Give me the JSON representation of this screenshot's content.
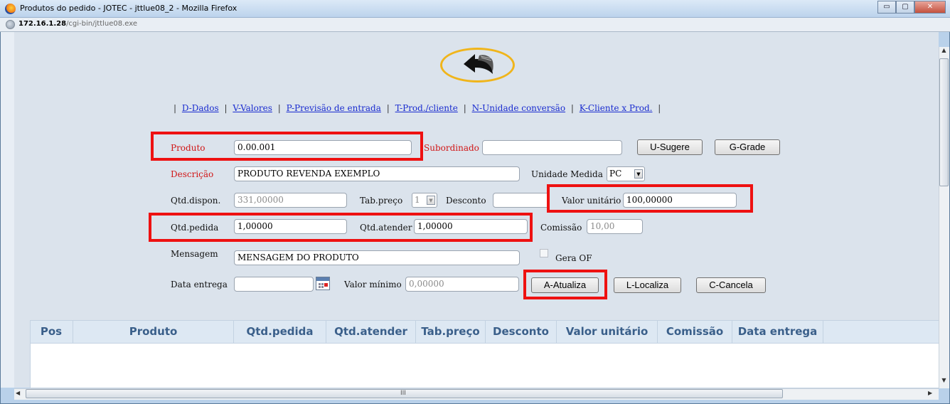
{
  "window": {
    "title": "Produtos do pedido - JOTEC - jttlue08_2 - Mozilla Firefox",
    "url_host": "172.16.1.28",
    "url_path": "/cgi-bin/jttlue08.exe",
    "controls": {
      "minimize": "▭",
      "maximize": "▢",
      "close": "✕"
    }
  },
  "nav": {
    "separator": "|",
    "links": [
      "D-Dados",
      "V-Valores",
      "P-Previsão de entrada",
      "T-Prod./cliente",
      "N-Unidade conversão",
      "K-Cliente x Prod."
    ]
  },
  "form": {
    "produto": {
      "label": "Produto",
      "value": "0.00.001"
    },
    "subordinado": {
      "label": "Subordinado",
      "value": ""
    },
    "descricao": {
      "label": "Descrição",
      "value": "PRODUTO REVENDA EXEMPLO"
    },
    "unidade_medida": {
      "label": "Unidade Medida",
      "value": "PC"
    },
    "qtd_dispon": {
      "label": "Qtd.dispon.",
      "value": "331,00000"
    },
    "tab_preco": {
      "label": "Tab.preço",
      "value": "1"
    },
    "desconto": {
      "label": "Desconto",
      "value": ""
    },
    "valor_unitario": {
      "label": "Valor unitário",
      "value": "100,00000"
    },
    "qtd_pedida": {
      "label": "Qtd.pedida",
      "value": "1,00000"
    },
    "qtd_atender": {
      "label": "Qtd.atender",
      "value": "1,00000"
    },
    "comissao": {
      "label": "Comissão",
      "value": "10,00"
    },
    "mensagem": {
      "label": "Mensagem",
      "value": "MENSAGEM DO PRODUTO"
    },
    "gera_of": {
      "label": "Gera OF",
      "checked": false
    },
    "data_entrega": {
      "label": "Data entrega",
      "value": ""
    },
    "valor_minimo": {
      "label": "Valor mínimo",
      "value": "0,00000"
    }
  },
  "buttons": {
    "sugere": "U-Sugere",
    "grade": "G-Grade",
    "atualiza": "A-Atualiza",
    "localiza": "L-Localiza",
    "cancela": "C-Cancela"
  },
  "table": {
    "columns": [
      "Pos",
      "Produto",
      "Qtd.pedida",
      "Qtd.atender",
      "Tab.preço",
      "Desconto",
      "Valor unitário",
      "Comissão",
      "Data entrega"
    ],
    "rows": []
  },
  "scroll": {
    "h_grip": "III"
  },
  "colors": {
    "highlight": "#ee1111",
    "back_circle": "#f0b51b",
    "required_label": "#d11616",
    "link": "#1a2ccf",
    "grid_header_text": "#3a5f8a"
  },
  "icons": {
    "back": "back-arrow-icon",
    "calendar": "calendar-icon",
    "app": "firefox-icon",
    "page": "globe-icon"
  }
}
